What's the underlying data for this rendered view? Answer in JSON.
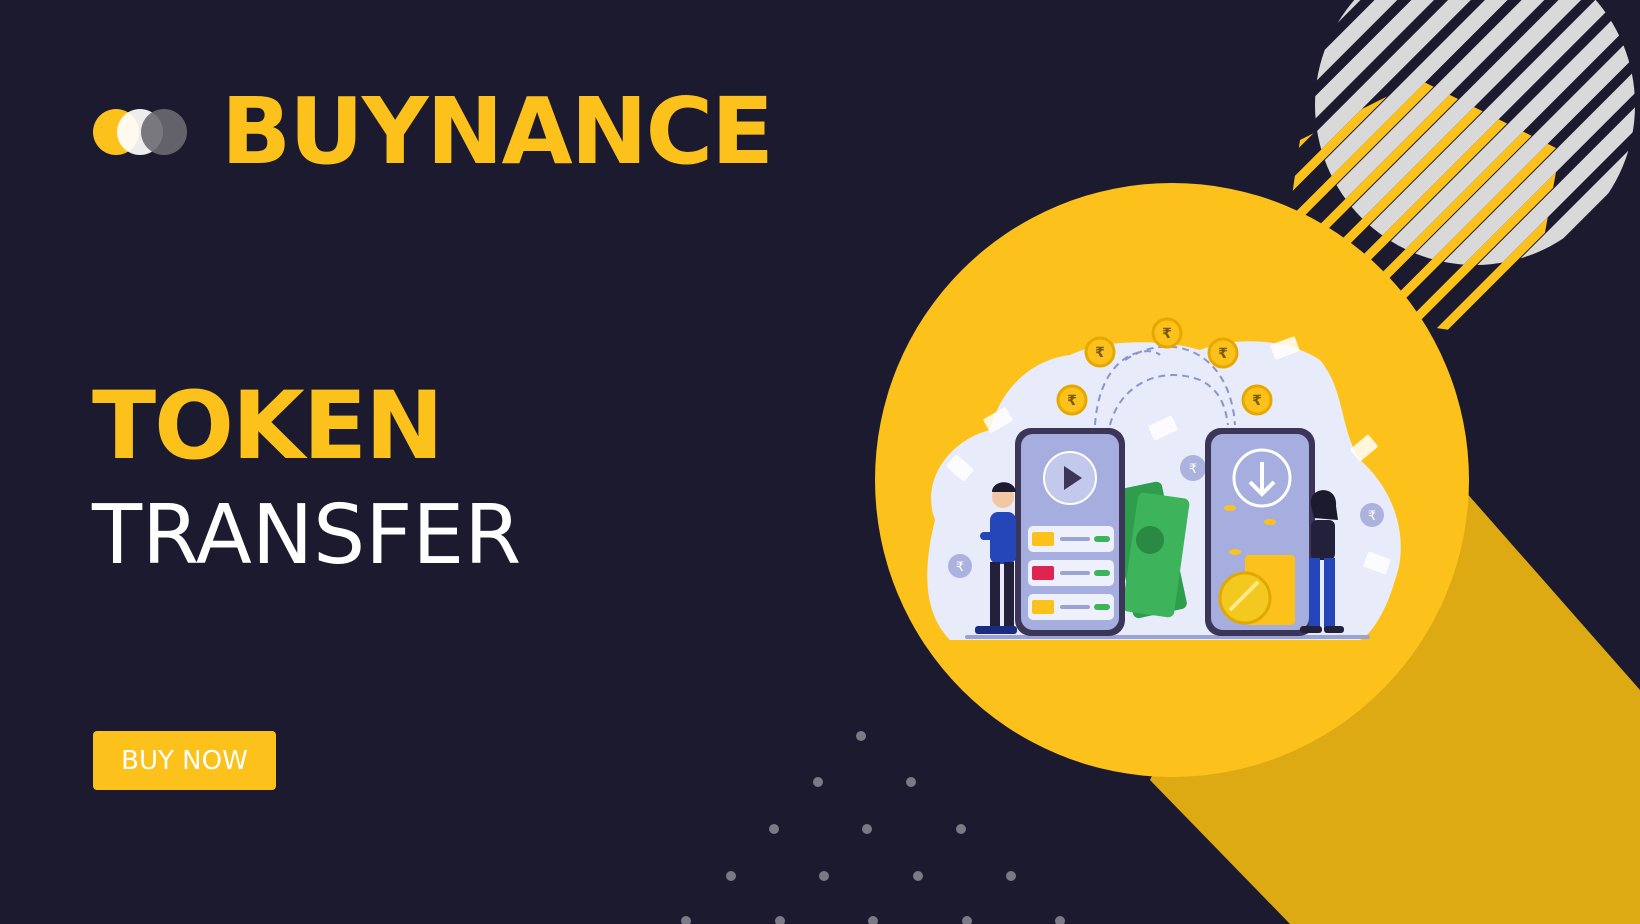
{
  "brand": {
    "name": "BUYNANCE",
    "logo_icon": "overlapping-circles-logo"
  },
  "hero": {
    "title_line1": "TOKEN",
    "title_line2": "TRANSFER",
    "cta_label": "BUY NOW"
  },
  "illustration": {
    "currency_symbol": "₹",
    "subject": "phone-to-phone-money-transfer"
  },
  "colors": {
    "background": "#1c1a2e",
    "accent": "#fcc21b",
    "accent_dark": "#ddaa14",
    "stripe_gray": "#d9d9d9",
    "text_light": "#ffffff"
  }
}
